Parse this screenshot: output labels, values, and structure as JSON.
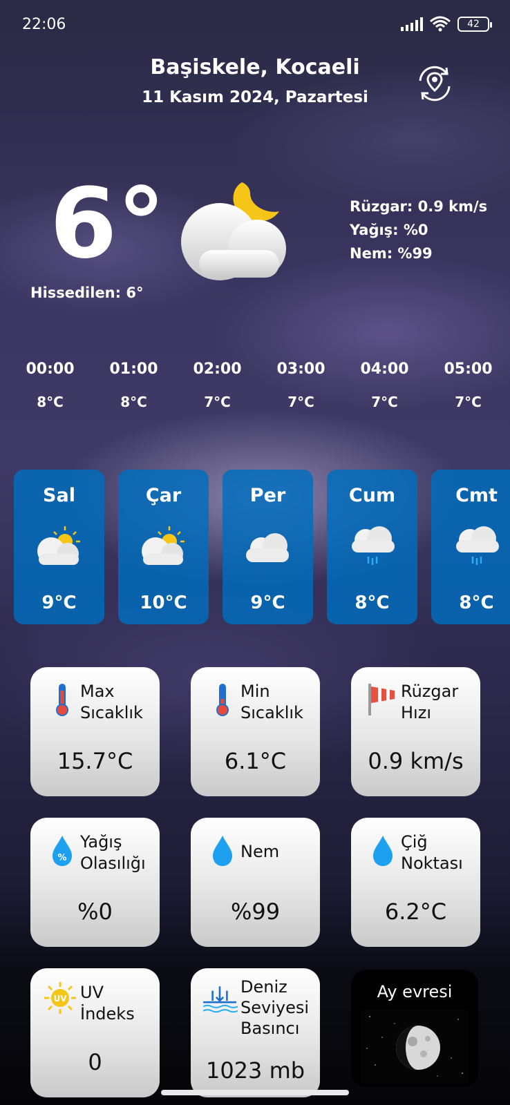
{
  "status": {
    "time": "22:06",
    "battery": "42"
  },
  "header": {
    "city": "Başiskele, Kocaeli",
    "date": "11 Kasım 2024, Pazartesi"
  },
  "current": {
    "temp": "6°",
    "feels_like": "Hissedilen: 6°",
    "icon": "cloud-moon-icon",
    "wind": "Rüzgar: 0.9 km/s",
    "precip": "Yağış: %0",
    "humidity": "Nem: %99"
  },
  "hourly": [
    {
      "time": "00:00",
      "temp": "8°C"
    },
    {
      "time": "01:00",
      "temp": "8°C"
    },
    {
      "time": "02:00",
      "temp": "7°C"
    },
    {
      "time": "03:00",
      "temp": "7°C"
    },
    {
      "time": "04:00",
      "temp": "7°C"
    },
    {
      "time": "05:00",
      "temp": "7°C"
    }
  ],
  "daily": [
    {
      "day": "Sal",
      "temp": "9°C",
      "icon": "sun-cloud-icon"
    },
    {
      "day": "Çar",
      "temp": "10°C",
      "icon": "sun-cloud-icon"
    },
    {
      "day": "Per",
      "temp": "9°C",
      "icon": "cloud-icon"
    },
    {
      "day": "Cum",
      "temp": "8°C",
      "icon": "rain-cloud-icon"
    },
    {
      "day": "Cmt",
      "temp": "8°C",
      "icon": "rain-cloud-icon"
    }
  ],
  "cards": {
    "max_temp": {
      "label1": "Max",
      "label2": "Sıcaklık",
      "value": "15.7°C",
      "icon": "thermometer-icon"
    },
    "min_temp": {
      "label1": "Min",
      "label2": "Sıcaklık",
      "value": "6.1°C",
      "icon": "thermometer-icon"
    },
    "wind_speed": {
      "label1": "Rüzgar",
      "label2": "Hızı",
      "value": "0.9 km/s",
      "icon": "windsock-icon"
    },
    "precip_prob": {
      "label1": "Yağış",
      "label2": "Olasılığı",
      "value": "%0",
      "icon": "percent-drop-icon"
    },
    "humidity": {
      "label1": "Nem",
      "value": "%99",
      "icon": "drop-icon"
    },
    "dew_point": {
      "label1": "Çiğ",
      "label2": "Noktası",
      "value": "6.2°C",
      "icon": "drop-icon"
    },
    "uv": {
      "label1": "UV",
      "label2": "İndeks",
      "value": "0",
      "icon_text": "UV",
      "icon": "uv-sun-icon"
    },
    "pressure": {
      "label1": "Deniz",
      "label2": "Seviyesi",
      "label3": "Basıncı",
      "value": "1023 mb",
      "icon": "sea-level-icon"
    },
    "moon": {
      "label": "Ay evresi",
      "icon": "moon-phase-icon"
    }
  },
  "colors": {
    "day_card": "#0a6fbe",
    "drop": "#1ea0f0",
    "thermo": "#e54a3c",
    "sun": "#f5c518"
  }
}
